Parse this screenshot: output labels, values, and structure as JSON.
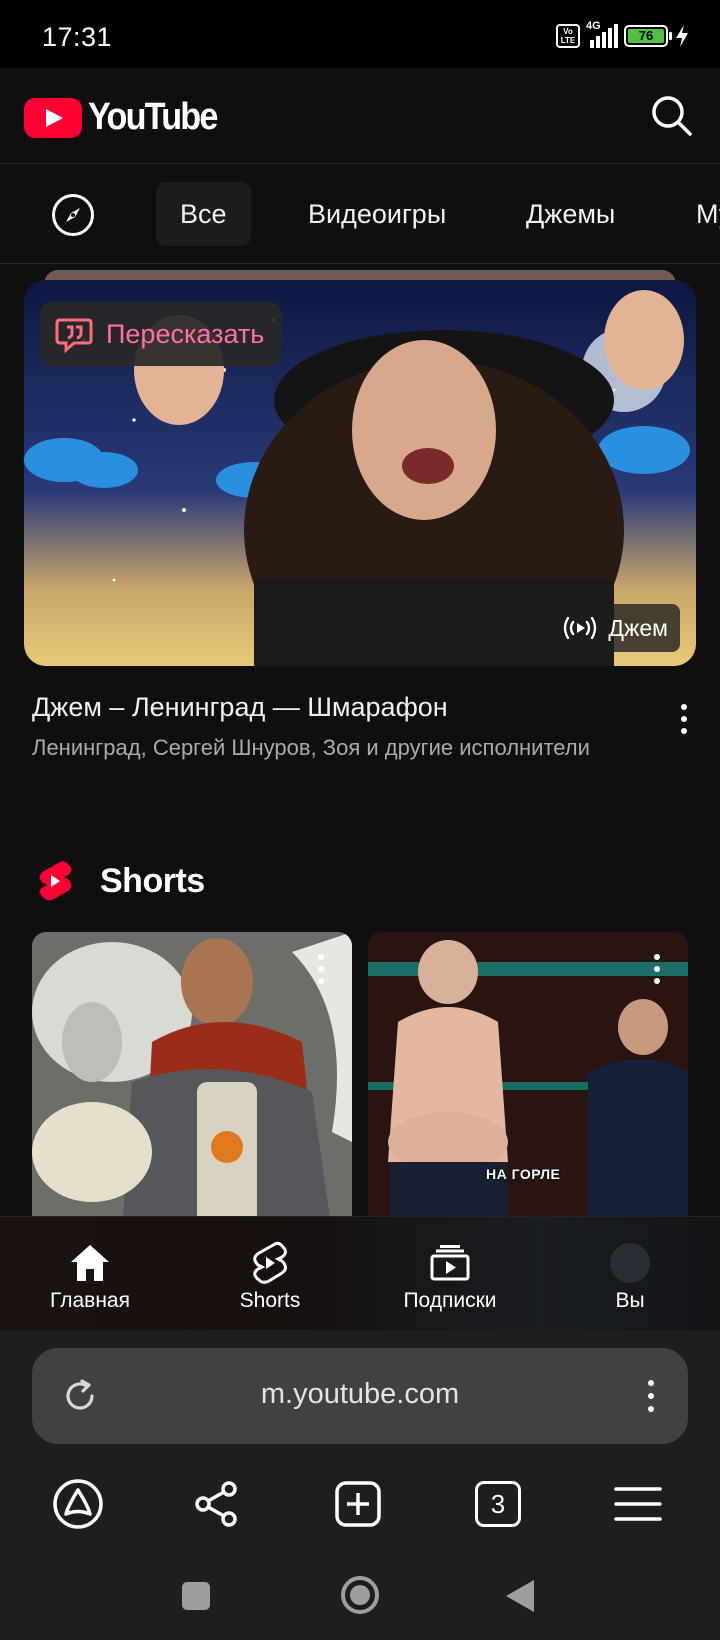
{
  "status_bar": {
    "time": "17:31",
    "network": "4G",
    "volte": "Vo LTE",
    "battery": "76",
    "charging": true
  },
  "header": {
    "app_name": "YouTube",
    "brand_color": "#ff0033",
    "search_icon": "search-icon"
  },
  "chips": {
    "explore_icon": "compass-icon",
    "items": [
      {
        "label": "Все",
        "active": true
      },
      {
        "label": "Видеоигры",
        "active": false
      },
      {
        "label": "Джемы",
        "active": false
      },
      {
        "label": "Музыка",
        "active": false
      }
    ]
  },
  "video": {
    "retell_label": "Пересказать",
    "badge_label": "Джем",
    "title": "Джем – Ленинград — Шмарафон",
    "meta": "Ленинград, Сергей Шнуров, Зоя и другие исполнители"
  },
  "shorts": {
    "heading": "Shorts",
    "items": [
      {
        "thumb": "armored-warrior-with-wolf"
      },
      {
        "thumb": "comedy-stage-scene",
        "caption": "НА ГОРЛЕ"
      }
    ]
  },
  "bottom_nav": {
    "items": [
      {
        "label": "Главная",
        "icon": "home-icon"
      },
      {
        "label": "Shorts",
        "icon": "shorts-icon"
      },
      {
        "label": "Подписки",
        "icon": "subscriptions-icon"
      },
      {
        "label": "Вы",
        "icon": "avatar-icon"
      }
    ]
  },
  "browser": {
    "url": "m.youtube.com",
    "tab_count": "3"
  }
}
